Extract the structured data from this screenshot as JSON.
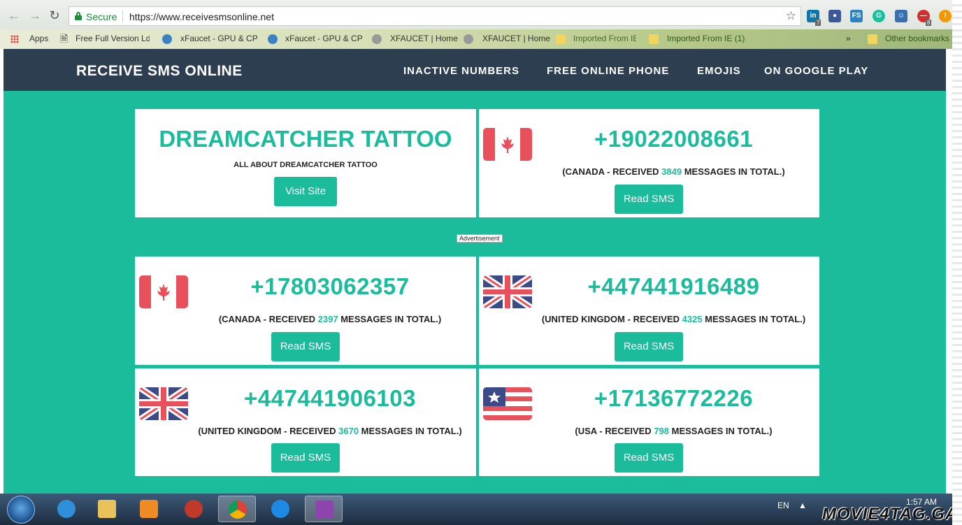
{
  "browser": {
    "secure_label": "Secure",
    "url": "https://www.receivesmsonline.net",
    "bookmarks": [
      "Apps",
      "Free Full Version Ld",
      "xFaucet - GPU & CPU",
      "xFaucet - GPU & CPU",
      "XFAUCET | Home",
      "XFAUCET | Home",
      "Imported From IE",
      "Imported From IE (1)",
      "»",
      "Other bookmarks"
    ],
    "extension_badges": [
      "7",
      "8"
    ]
  },
  "header": {
    "brand": "RECEIVE SMS ONLINE",
    "nav": [
      "INACTIVE NUMBERS",
      "FREE ONLINE PHONE",
      "EMOJIS",
      "ON GOOGLE PLAY"
    ]
  },
  "ad_card": {
    "title": "DREAMCATCHER TATTOO",
    "subtitle": "ALL ABOUT DREAMCATCHER TATTOO",
    "button": "Visit Site"
  },
  "ad_label": "Advertisement",
  "numbers": [
    {
      "phone": "+19022008661",
      "country": "CANADA",
      "count": "3849",
      "flag": "canada",
      "button": "Read SMS"
    },
    {
      "phone": "+17803062357",
      "country": "CANADA",
      "count": "2397",
      "flag": "canada",
      "button": "Read SMS"
    },
    {
      "phone": "+447441916489",
      "country": "UNITED KINGDOM",
      "count": "4325",
      "flag": "uk",
      "button": "Read SMS"
    },
    {
      "phone": "+447441906103",
      "country": "UNITED KINGDOM",
      "count": "3670",
      "flag": "uk",
      "button": "Read SMS"
    },
    {
      "phone": "+17136772226",
      "country": "USA",
      "count": "798",
      "flag": "usa",
      "button": "Read SMS"
    }
  ],
  "text": {
    "received_prefix": " - RECEIVED ",
    "received_suffix": " MESSAGES IN TOTAL.)",
    "open_paren": "("
  },
  "taskbar": {
    "language": "EN",
    "time": "1:57 AM"
  },
  "watermark": "MOVIE4TAG.GA",
  "colors": {
    "accent": "#1abc9c",
    "header": "#2c3e50"
  }
}
